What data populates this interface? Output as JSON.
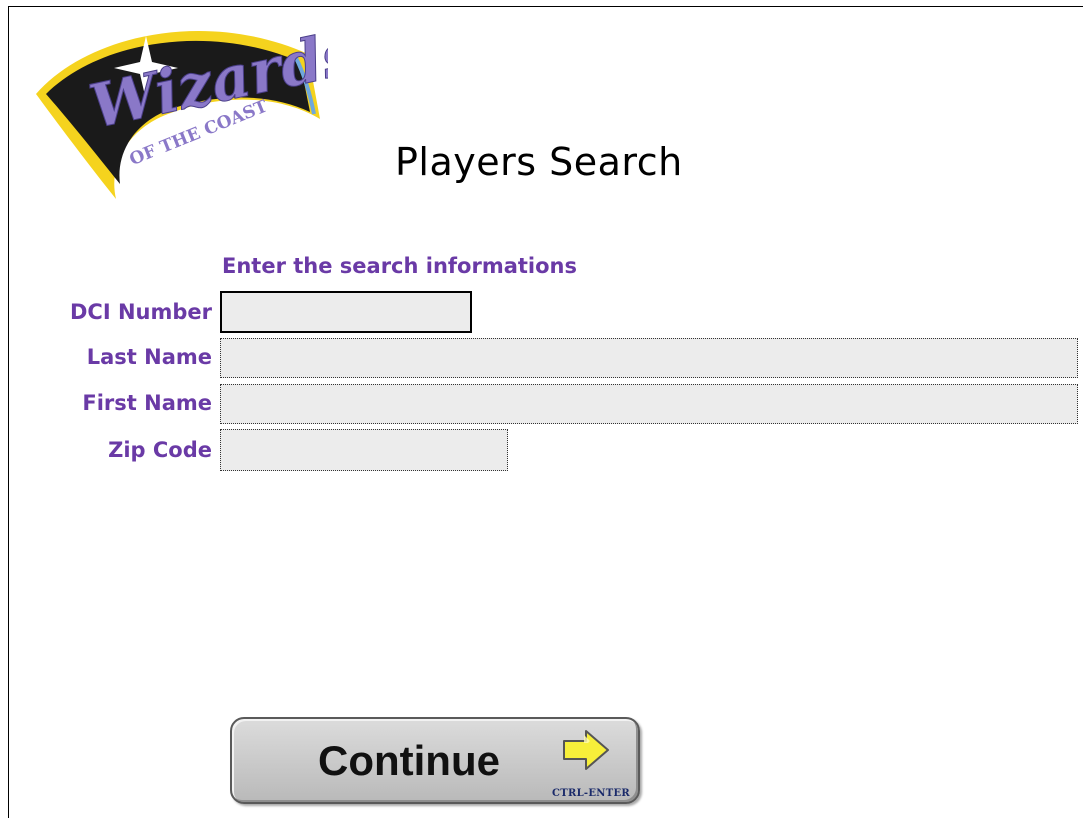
{
  "brand": {
    "logo_line1": "Wizards",
    "logo_line2": "OF THE COAST"
  },
  "page": {
    "title": "Players Search",
    "instructions": "Enter the search informations"
  },
  "form": {
    "dci_number": {
      "label": "DCI Number",
      "value": ""
    },
    "last_name": {
      "label": "Last Name",
      "value": ""
    },
    "first_name": {
      "label": "First Name",
      "value": ""
    },
    "zip_code": {
      "label": "Zip Code",
      "value": ""
    }
  },
  "continue_button": {
    "label": "Continue",
    "shortcut": "CTRL-ENTER",
    "icon": "arrow-right-icon"
  },
  "colors": {
    "label_purple": "#6a3aa6",
    "field_bg": "#ececec",
    "logo_yellow": "#f5d31e",
    "logo_purple": "#8a78c8"
  }
}
